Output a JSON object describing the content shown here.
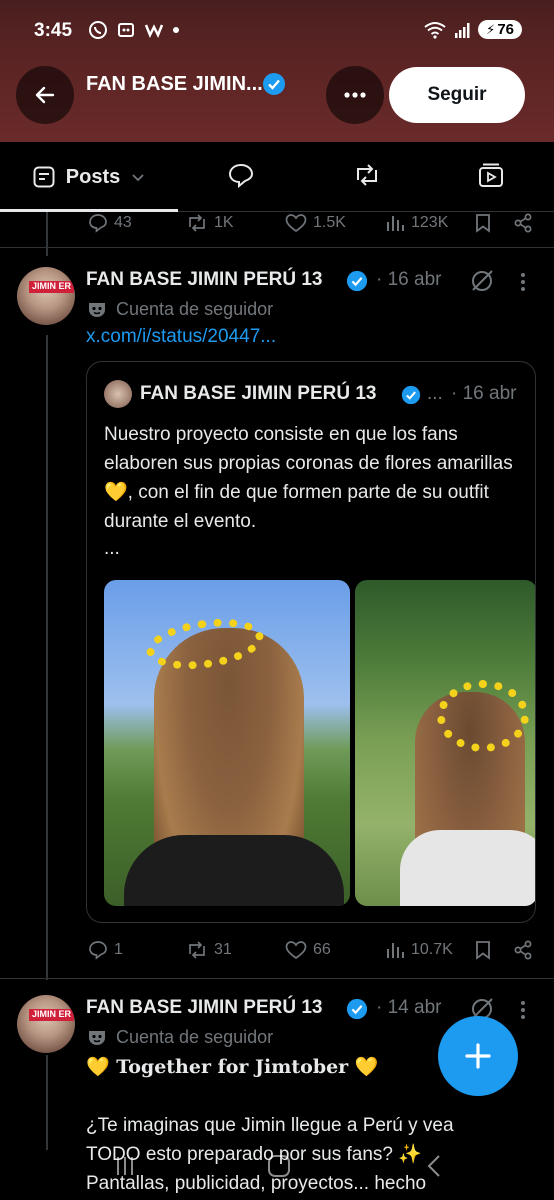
{
  "status_bar": {
    "time": "3:45",
    "battery": "76",
    "left_icons": [
      "whatsapp-icon",
      "app-icon",
      "w-icon",
      "dot"
    ],
    "right_icons": [
      "wifi-icon",
      "signal-icon",
      "battery-icon"
    ]
  },
  "header": {
    "title": "FAN BASE JIMIN...",
    "follow_label": "Seguir"
  },
  "tabs": {
    "items": [
      {
        "label": "Posts",
        "icon": "posts-icon",
        "active": true
      },
      {
        "label": "",
        "icon": "replies-icon"
      },
      {
        "label": "",
        "icon": "reposts-icon"
      },
      {
        "label": "",
        "icon": "media-icon"
      }
    ]
  },
  "prev_post_actions": {
    "replies": "43",
    "reposts": "1K",
    "likes": "1.5K",
    "views": "123K"
  },
  "post1": {
    "author": "FAN BASE JIMIN PERÚ 13",
    "date": "· 16 abr",
    "account_label": "Cuenta de seguidor",
    "link": "x.com/i/status/20447...",
    "avatar_tag": "JIMIN ER",
    "quote": {
      "author": "FAN BASE JIMIN PERÚ 13",
      "ellipsis_after_badge": "...",
      "date": "· 16 abr",
      "text": "Nuestro proyecto consiste en que los fans elaboren sus propias coronas de flores amarillas 💛, con el fin de que formen parte de su outfit durante el evento.",
      "more": "..."
    },
    "actions": {
      "replies": "1",
      "reposts": "31",
      "likes": "66",
      "views": "10.7K"
    }
  },
  "post2": {
    "author": "FAN BASE JIMIN PERÚ 13",
    "date": "· 14 abr",
    "account_label": "Cuenta de seguidor",
    "avatar_tag": "JIMIN ER",
    "headline": "💛 Together for Jimtober 💛",
    "body_line1": "¿Te imaginas que Jimin llegue a Perú y vea",
    "body_line2": "TODO esto preparado por sus fans? ✨",
    "body_line3": "Pantallas, publicidad, proyectos... hecho"
  },
  "colors": {
    "accent": "#1d9bf0",
    "header_bg": "#5c2424",
    "muted": "#71767b",
    "text": "#e7e9ea"
  }
}
